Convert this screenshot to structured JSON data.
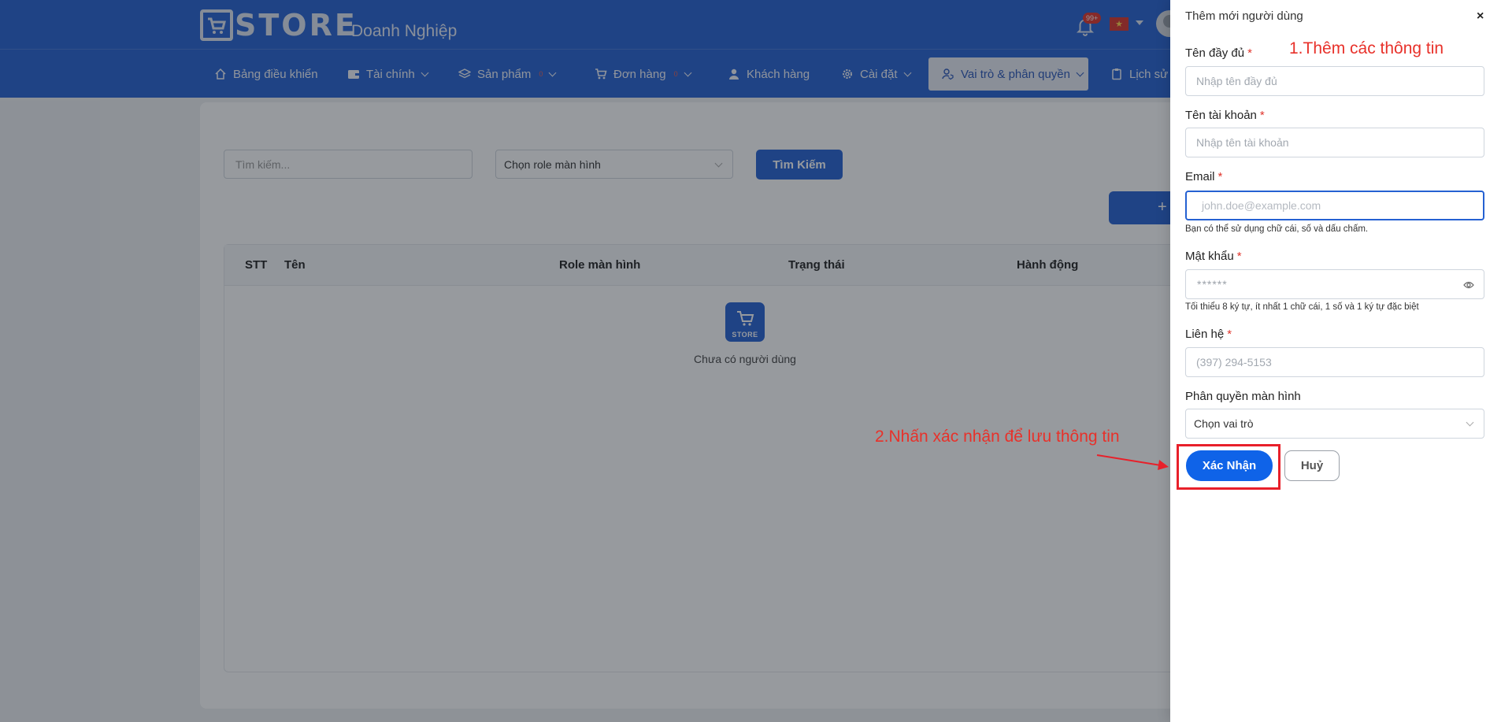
{
  "header": {
    "logo_text": "STORE",
    "subtitle": "Doanh Nghiệp",
    "notification_badge": "99+"
  },
  "nav": {
    "items": [
      {
        "label": "Bảng điều khiển",
        "icon": "home-icon",
        "has_caret": false,
        "badge": ""
      },
      {
        "label": "Tài chính",
        "icon": "wallet-icon",
        "has_caret": true,
        "badge": ""
      },
      {
        "label": "Sản phẩm",
        "icon": "layers-icon",
        "has_caret": true,
        "badge": "0"
      },
      {
        "label": "Đơn hàng",
        "icon": "cart-icon",
        "has_caret": true,
        "badge": "0"
      },
      {
        "label": "Khách hàng",
        "icon": "user-icon",
        "has_caret": false,
        "badge": ""
      },
      {
        "label": "Cài đặt",
        "icon": "gear-icon",
        "has_caret": true,
        "badge": ""
      },
      {
        "label": "Vai trò & phân quyền",
        "icon": "user-shield-icon",
        "has_caret": true,
        "badge": "",
        "active": true
      },
      {
        "label": "Lịch sử l",
        "icon": "clipboard-icon",
        "has_caret": false,
        "badge": ""
      }
    ]
  },
  "filters": {
    "search_placeholder": "Tìm kiếm...",
    "role_select_value": "Chọn role màn hình",
    "search_button": "Tìm Kiếm",
    "add_button": "+"
  },
  "table": {
    "columns": [
      "STT",
      "Tên",
      "Role màn hình",
      "Trạng thái",
      "Hành động"
    ],
    "empty_icon_text": "STORE",
    "empty_text": "Chưa có người dùng"
  },
  "drawer": {
    "title": "Thêm mới người dùng",
    "close": "×",
    "fields": {
      "full_name": {
        "label": "Tên đầy đủ",
        "required": "*",
        "placeholder": "Nhập tên đầy đủ"
      },
      "username": {
        "label": "Tên tài khoản",
        "required": "*",
        "placeholder": "Nhập tên tài khoản"
      },
      "email": {
        "label": "Email",
        "required": "*",
        "placeholder": "john.doe@example.com",
        "hint": "Bạn có thể sử dụng chữ cái, số và dấu chấm."
      },
      "password": {
        "label": "Mật khẩu",
        "required": "*",
        "placeholder": "******",
        "hint": "Tối thiểu 8 ký tự, ít nhất 1 chữ cái, 1 số và 1 ký tự đặc biệt"
      },
      "contact": {
        "label": "Liên hệ",
        "required": "*",
        "placeholder": "(397) 294-5153"
      },
      "role": {
        "label": "Phân quyền màn hình",
        "value": "Chọn vai trò"
      }
    },
    "confirm_button": "Xác Nhận",
    "cancel_button": "Huỷ"
  },
  "annotations": {
    "step1": "1.Thêm các thông tin",
    "step2": "2.Nhấn xác nhận để lưu thông tin"
  },
  "colors": {
    "primary": "#2561d2",
    "annotation": "#e8312a"
  }
}
